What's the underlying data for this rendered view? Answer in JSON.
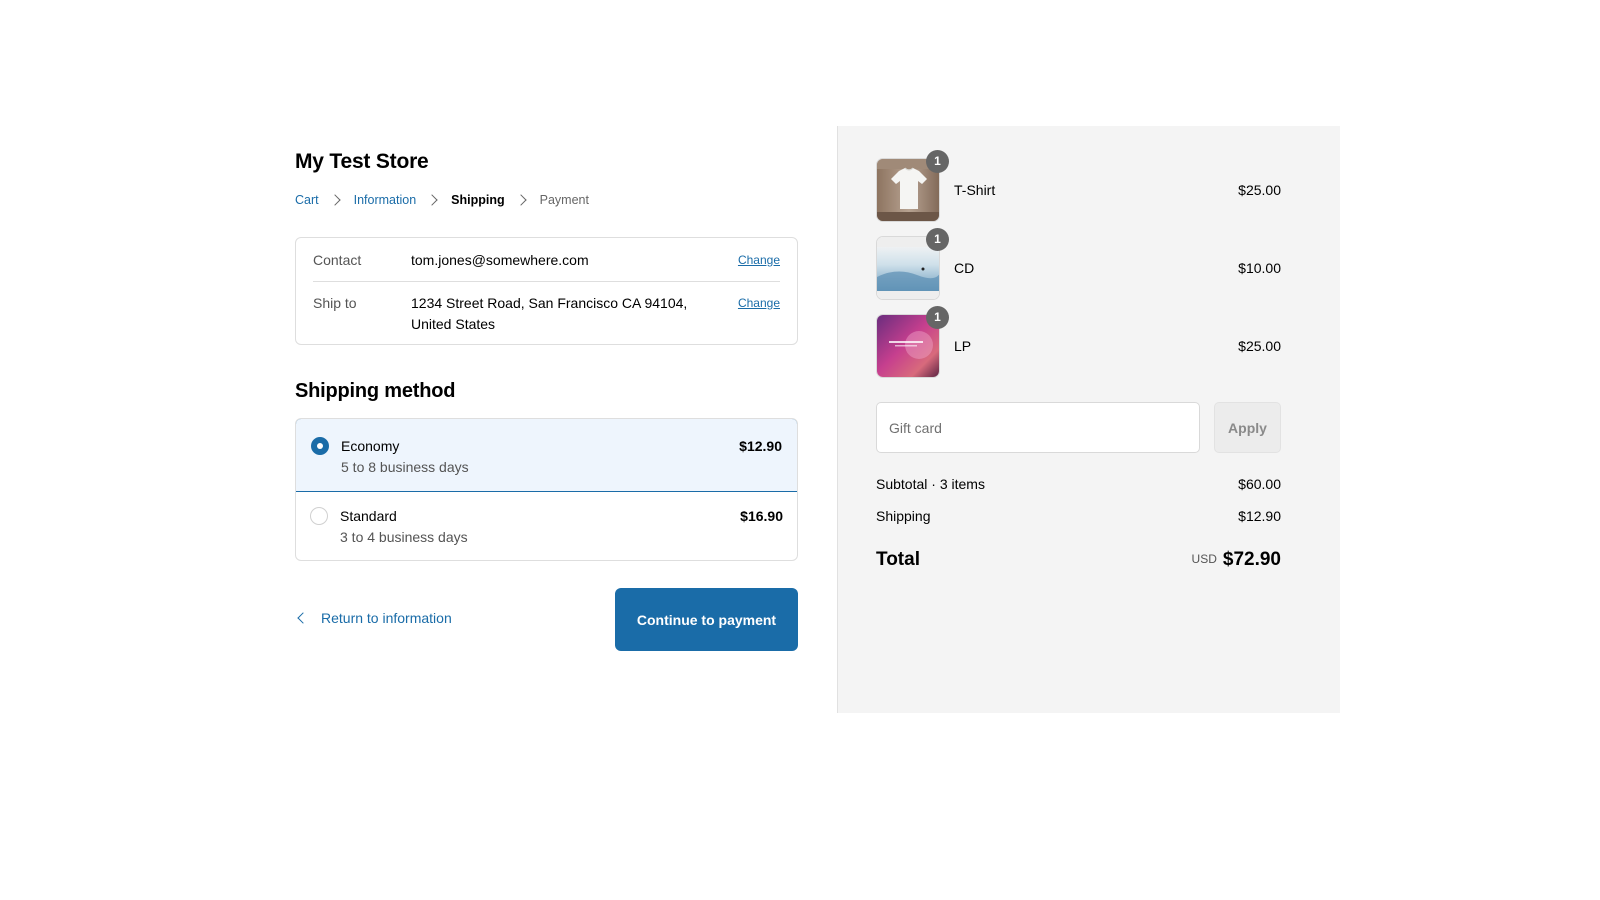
{
  "store": {
    "name": "My Test Store"
  },
  "breadcrumb": {
    "cart": "Cart",
    "information": "Information",
    "shipping": "Shipping",
    "payment": "Payment"
  },
  "review": {
    "contact_label": "Contact",
    "contact_value": "tom.jones@somewhere.com",
    "ship_to_label": "Ship to",
    "ship_to_value": "1234 Street Road, San Francisco CA 94104, United States",
    "change_label": "Change"
  },
  "shipping_method": {
    "title": "Shipping method",
    "options": [
      {
        "name": "Economy",
        "description": "5 to 8 business days",
        "price": "$12.90",
        "selected": true
      },
      {
        "name": "Standard",
        "description": "3 to 4 business days",
        "price": "$16.90",
        "selected": false
      }
    ]
  },
  "actions": {
    "return_label": "Return to information",
    "continue_label": "Continue to payment"
  },
  "cart": {
    "items": [
      {
        "name": "T-Shirt",
        "price": "$25.00",
        "quantity": "1"
      },
      {
        "name": "CD",
        "price": "$10.00",
        "quantity": "1"
      },
      {
        "name": "LP",
        "price": "$25.00",
        "quantity": "1"
      }
    ]
  },
  "gift_card": {
    "placeholder": "Gift card",
    "apply_label": "Apply"
  },
  "summary": {
    "subtotal_label": "Subtotal · 3 items",
    "subtotal_value": "$60.00",
    "shipping_label": "Shipping",
    "shipping_value": "$12.90",
    "total_label": "Total",
    "currency": "USD",
    "total_value": "$72.90"
  },
  "colors": {
    "accent": "#1a6ca8",
    "sidebar_bg": "#f4f4f4",
    "selected_bg": "#eef5fd"
  }
}
